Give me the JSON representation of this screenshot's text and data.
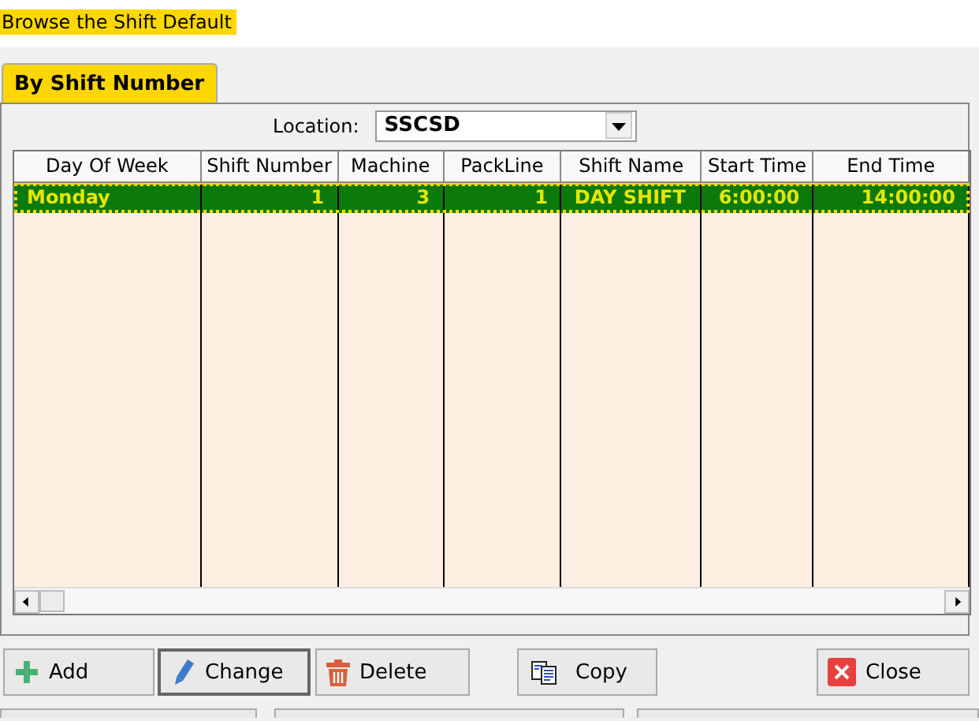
{
  "window": {
    "title": "Browse the Shift Default"
  },
  "tabs": [
    {
      "label": "By Shift Number",
      "selected": true
    }
  ],
  "location": {
    "label": "Location:",
    "value": "SSCSD"
  },
  "table": {
    "columns": [
      {
        "label": "Day Of Week",
        "kind": "text"
      },
      {
        "label": "Shift Number",
        "kind": "number"
      },
      {
        "label": "Machine",
        "kind": "number"
      },
      {
        "label": "PackLine",
        "kind": "number"
      },
      {
        "label": "Shift Name",
        "kind": "text"
      },
      {
        "label": "Start Time",
        "kind": "number"
      },
      {
        "label": "End Time",
        "kind": "number"
      }
    ],
    "rows": [
      {
        "selected": true,
        "cells": [
          "Monday",
          "1",
          "3",
          "1",
          "DAY SHIFT",
          "6:00:00",
          "14:00:00"
        ]
      }
    ]
  },
  "buttons": [
    {
      "label": "Add",
      "kind": "add"
    },
    {
      "label": "Change",
      "kind": "change",
      "selected": true
    },
    {
      "label": "Delete",
      "kind": "delete"
    },
    {
      "label": "Copy",
      "kind": "copy"
    },
    {
      "label": "Close",
      "kind": "close"
    }
  ]
}
